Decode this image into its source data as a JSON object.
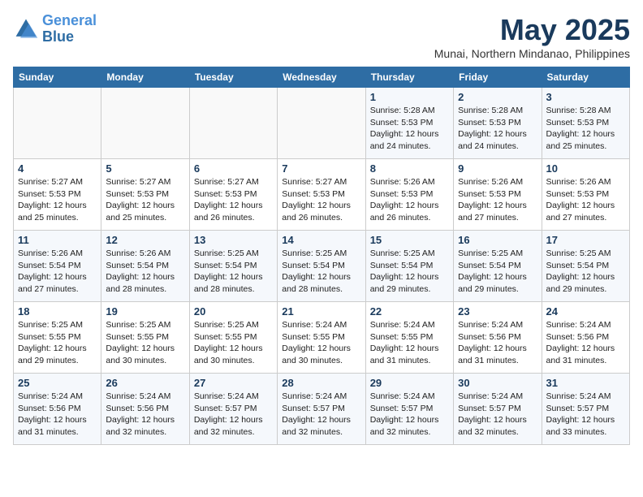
{
  "header": {
    "logo_line1": "General",
    "logo_line2": "Blue",
    "month_title": "May 2025",
    "location": "Munai, Northern Mindanao, Philippines"
  },
  "weekdays": [
    "Sunday",
    "Monday",
    "Tuesday",
    "Wednesday",
    "Thursday",
    "Friday",
    "Saturday"
  ],
  "weeks": [
    [
      {
        "day": "",
        "info": ""
      },
      {
        "day": "",
        "info": ""
      },
      {
        "day": "",
        "info": ""
      },
      {
        "day": "",
        "info": ""
      },
      {
        "day": "1",
        "info": "Sunrise: 5:28 AM\nSunset: 5:53 PM\nDaylight: 12 hours and 24 minutes."
      },
      {
        "day": "2",
        "info": "Sunrise: 5:28 AM\nSunset: 5:53 PM\nDaylight: 12 hours and 24 minutes."
      },
      {
        "day": "3",
        "info": "Sunrise: 5:28 AM\nSunset: 5:53 PM\nDaylight: 12 hours and 25 minutes."
      }
    ],
    [
      {
        "day": "4",
        "info": "Sunrise: 5:27 AM\nSunset: 5:53 PM\nDaylight: 12 hours and 25 minutes."
      },
      {
        "day": "5",
        "info": "Sunrise: 5:27 AM\nSunset: 5:53 PM\nDaylight: 12 hours and 25 minutes."
      },
      {
        "day": "6",
        "info": "Sunrise: 5:27 AM\nSunset: 5:53 PM\nDaylight: 12 hours and 26 minutes."
      },
      {
        "day": "7",
        "info": "Sunrise: 5:27 AM\nSunset: 5:53 PM\nDaylight: 12 hours and 26 minutes."
      },
      {
        "day": "8",
        "info": "Sunrise: 5:26 AM\nSunset: 5:53 PM\nDaylight: 12 hours and 26 minutes."
      },
      {
        "day": "9",
        "info": "Sunrise: 5:26 AM\nSunset: 5:53 PM\nDaylight: 12 hours and 27 minutes."
      },
      {
        "day": "10",
        "info": "Sunrise: 5:26 AM\nSunset: 5:53 PM\nDaylight: 12 hours and 27 minutes."
      }
    ],
    [
      {
        "day": "11",
        "info": "Sunrise: 5:26 AM\nSunset: 5:54 PM\nDaylight: 12 hours and 27 minutes."
      },
      {
        "day": "12",
        "info": "Sunrise: 5:26 AM\nSunset: 5:54 PM\nDaylight: 12 hours and 28 minutes."
      },
      {
        "day": "13",
        "info": "Sunrise: 5:25 AM\nSunset: 5:54 PM\nDaylight: 12 hours and 28 minutes."
      },
      {
        "day": "14",
        "info": "Sunrise: 5:25 AM\nSunset: 5:54 PM\nDaylight: 12 hours and 28 minutes."
      },
      {
        "day": "15",
        "info": "Sunrise: 5:25 AM\nSunset: 5:54 PM\nDaylight: 12 hours and 29 minutes."
      },
      {
        "day": "16",
        "info": "Sunrise: 5:25 AM\nSunset: 5:54 PM\nDaylight: 12 hours and 29 minutes."
      },
      {
        "day": "17",
        "info": "Sunrise: 5:25 AM\nSunset: 5:54 PM\nDaylight: 12 hours and 29 minutes."
      }
    ],
    [
      {
        "day": "18",
        "info": "Sunrise: 5:25 AM\nSunset: 5:55 PM\nDaylight: 12 hours and 29 minutes."
      },
      {
        "day": "19",
        "info": "Sunrise: 5:25 AM\nSunset: 5:55 PM\nDaylight: 12 hours and 30 minutes."
      },
      {
        "day": "20",
        "info": "Sunrise: 5:25 AM\nSunset: 5:55 PM\nDaylight: 12 hours and 30 minutes."
      },
      {
        "day": "21",
        "info": "Sunrise: 5:24 AM\nSunset: 5:55 PM\nDaylight: 12 hours and 30 minutes."
      },
      {
        "day": "22",
        "info": "Sunrise: 5:24 AM\nSunset: 5:55 PM\nDaylight: 12 hours and 31 minutes."
      },
      {
        "day": "23",
        "info": "Sunrise: 5:24 AM\nSunset: 5:56 PM\nDaylight: 12 hours and 31 minutes."
      },
      {
        "day": "24",
        "info": "Sunrise: 5:24 AM\nSunset: 5:56 PM\nDaylight: 12 hours and 31 minutes."
      }
    ],
    [
      {
        "day": "25",
        "info": "Sunrise: 5:24 AM\nSunset: 5:56 PM\nDaylight: 12 hours and 31 minutes."
      },
      {
        "day": "26",
        "info": "Sunrise: 5:24 AM\nSunset: 5:56 PM\nDaylight: 12 hours and 32 minutes."
      },
      {
        "day": "27",
        "info": "Sunrise: 5:24 AM\nSunset: 5:57 PM\nDaylight: 12 hours and 32 minutes."
      },
      {
        "day": "28",
        "info": "Sunrise: 5:24 AM\nSunset: 5:57 PM\nDaylight: 12 hours and 32 minutes."
      },
      {
        "day": "29",
        "info": "Sunrise: 5:24 AM\nSunset: 5:57 PM\nDaylight: 12 hours and 32 minutes."
      },
      {
        "day": "30",
        "info": "Sunrise: 5:24 AM\nSunset: 5:57 PM\nDaylight: 12 hours and 32 minutes."
      },
      {
        "day": "31",
        "info": "Sunrise: 5:24 AM\nSunset: 5:57 PM\nDaylight: 12 hours and 33 minutes."
      }
    ]
  ]
}
